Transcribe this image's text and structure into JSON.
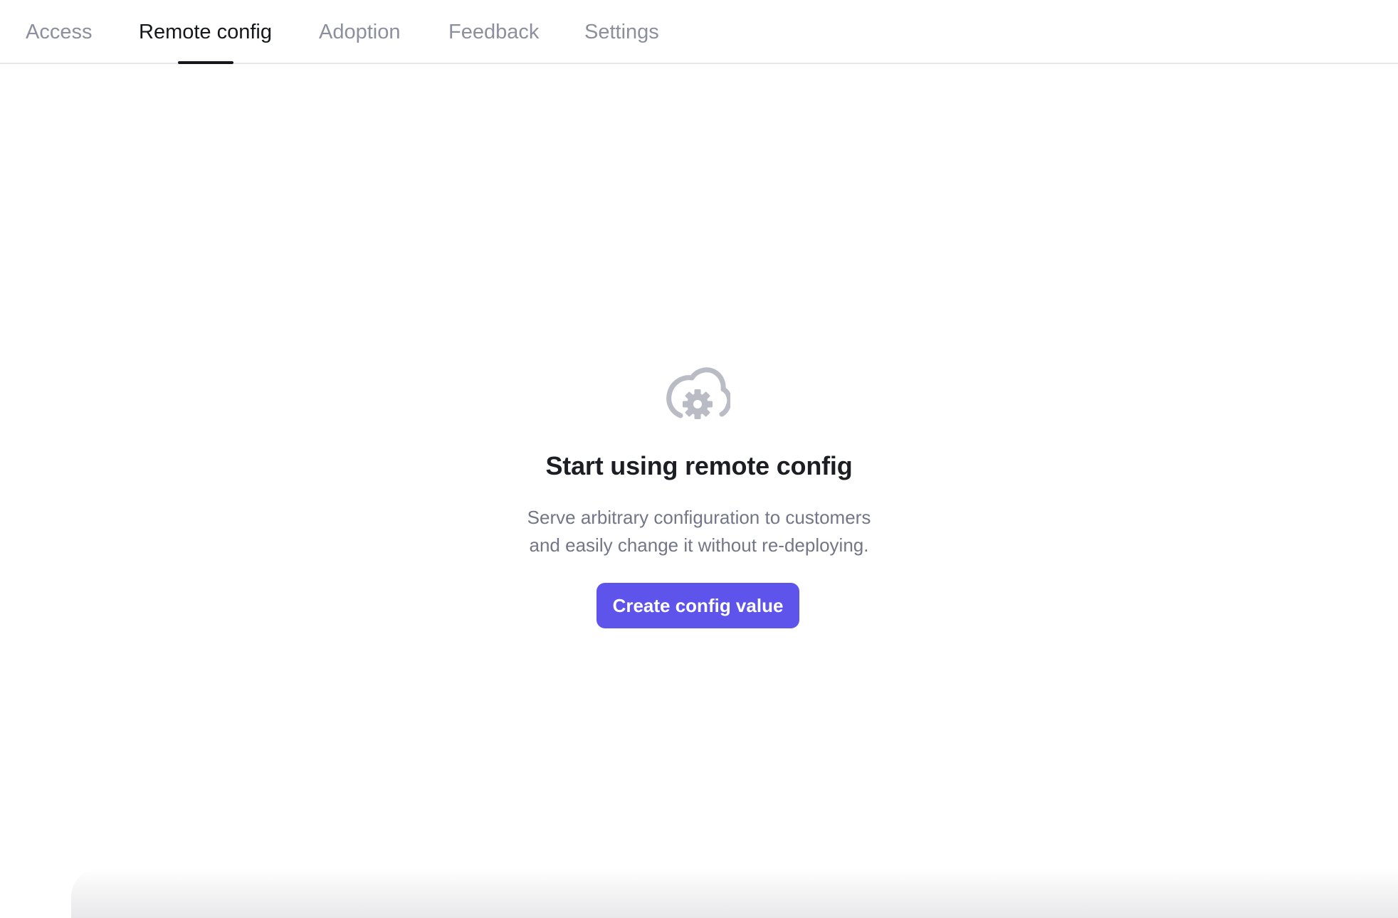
{
  "tabs": [
    {
      "label": "Access",
      "active": false
    },
    {
      "label": "Remote config",
      "active": true
    },
    {
      "label": "Adoption",
      "active": false
    },
    {
      "label": "Feedback",
      "active": false
    },
    {
      "label": "Settings",
      "active": false
    }
  ],
  "empty_state": {
    "icon": "cloud-gear-icon",
    "title": "Start using remote config",
    "description_line1": "Serve arbitrary configuration to customers",
    "description_line2": "and easily change it without re-deploying.",
    "button_label": "Create config value"
  },
  "colors": {
    "accent": "#5e54eb",
    "text_primary": "#15171c",
    "text_muted": "#8b8f9e",
    "icon": "#b9bbc5"
  }
}
